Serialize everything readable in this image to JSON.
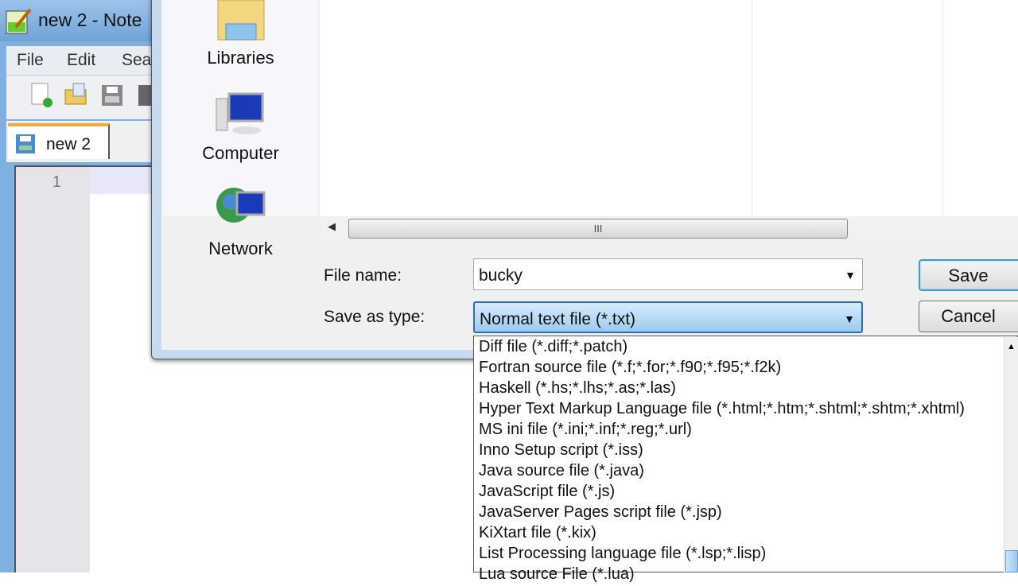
{
  "notepad": {
    "title": "new  2 - Note",
    "menu": [
      "File",
      "Edit",
      "Sea"
    ],
    "tab": "new  2",
    "line_number": "1"
  },
  "dialog": {
    "nav": [
      "Libraries",
      "Computer",
      "Network"
    ],
    "scroll_thumb": "III",
    "file_name_label": "File name:",
    "file_name_value": "bucky",
    "save_type_label": "Save as type:",
    "save_type_value": "Normal text file (*.txt)",
    "save_label": "Save",
    "cancel_label": "Cancel",
    "type_options": [
      "Diff file (*.diff;*.patch)",
      "Fortran source file (*.f;*.for;*.f90;*.f95;*.f2k)",
      "Haskell (*.hs;*.lhs;*.as;*.las)",
      "Hyper Text Markup Language file (*.html;*.htm;*.shtml;*.shtm;*.xhtml)",
      "MS ini file (*.ini;*.inf;*.reg;*.url)",
      "Inno Setup script (*.iss)",
      "Java source file (*.java)",
      "JavaScript file (*.js)",
      "JavaServer Pages script file (*.jsp)",
      "KiXtart file (*.kix)",
      "List Processing language file (*.lsp;*.lisp)",
      "Lua source File (*.lua)"
    ]
  }
}
